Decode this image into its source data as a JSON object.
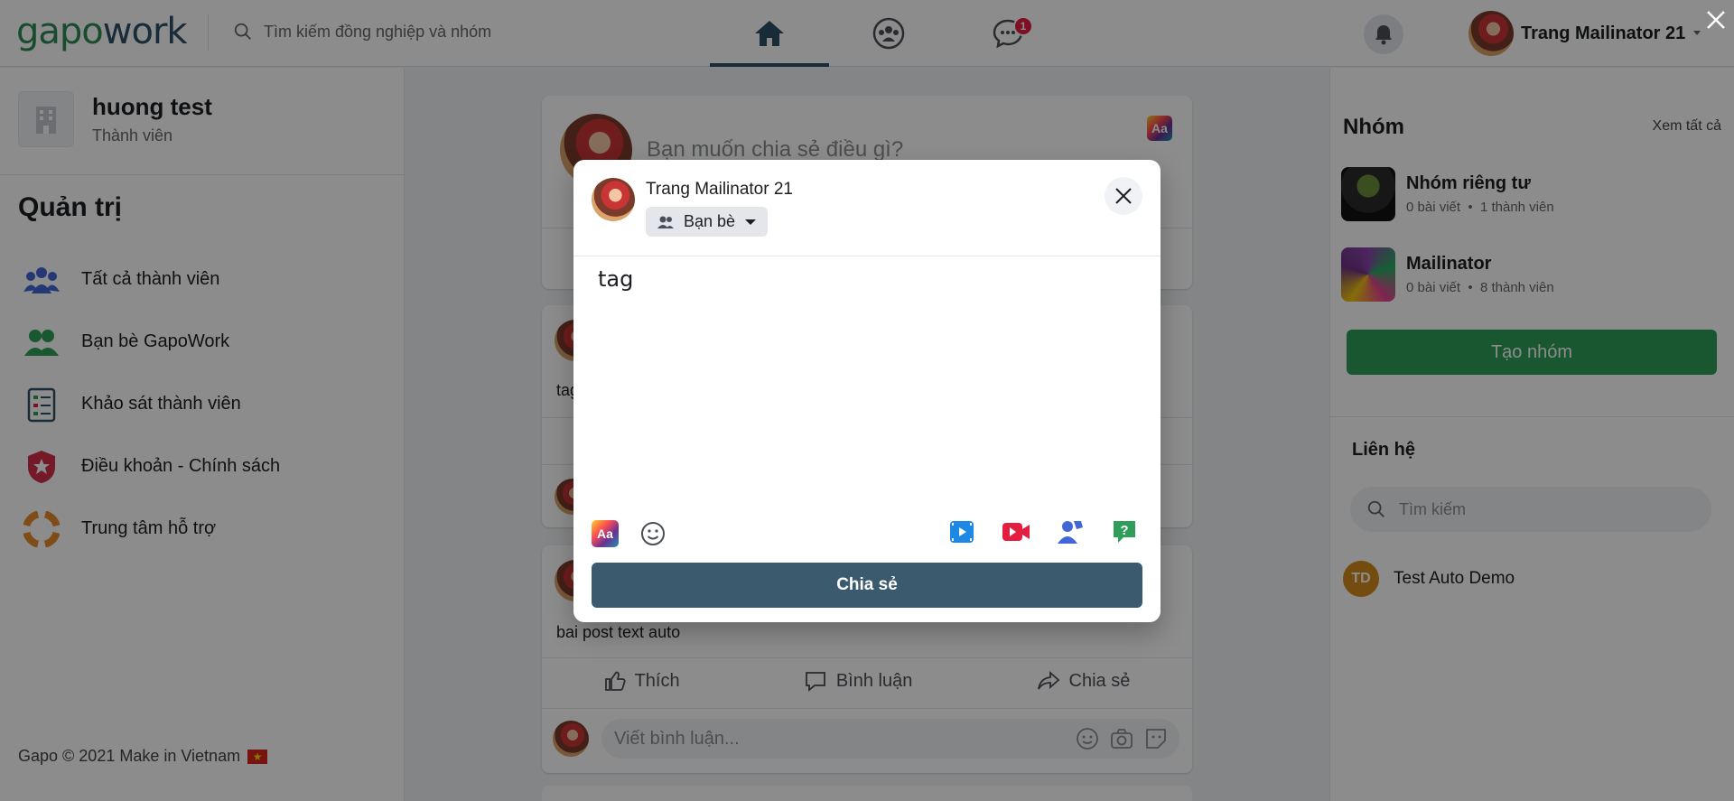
{
  "header": {
    "logo_part1": "gapo",
    "logo_part2": "work",
    "search_placeholder": "Tìm kiếm đồng nghiệp và nhóm",
    "chat_badge": "1",
    "user_name": "Trang Mailinator 21",
    "colors": {
      "brand_green": "#2e8b57",
      "brand_navy": "#2b5166",
      "badge_red": "#e41e3f"
    }
  },
  "left_sidebar": {
    "org_name": "huong test",
    "org_role": "Thành viên",
    "admin_title": "Quản trị",
    "menu": [
      {
        "label": "Tất cả thành viên",
        "icon": "members-icon"
      },
      {
        "label": "Bạn bè GapoWork",
        "icon": "friends-icon"
      },
      {
        "label": "Khảo sát thành viên",
        "icon": "survey-icon"
      },
      {
        "label": "Điều khoản - Chính sách",
        "icon": "policy-shield-icon"
      },
      {
        "label": "Trung tâm hỗ trợ",
        "icon": "lifebuoy-icon"
      }
    ],
    "footer": "Gapo © 2021 Make in Vietnam"
  },
  "feed": {
    "composer_placeholder": "Bạn muốn chia sẻ điều gì?",
    "post1_text": "tag",
    "post2_text": "bai post text auto",
    "actions": {
      "like": "Thích",
      "comment": "Bình luận",
      "share": "Chia sẻ"
    },
    "comment_placeholder": "Viết bình luận..."
  },
  "right_sidebar": {
    "groups_title": "Nhóm",
    "see_all": "Xem tất cả",
    "groups": [
      {
        "name": "Nhóm riêng tư",
        "posts": "0 bài viết",
        "members": "1 thành viên"
      },
      {
        "name": "Mailinator",
        "posts": "0 bài viết",
        "members": "8 thành viên"
      }
    ],
    "create_group": "Tạo nhóm",
    "contacts_title": "Liên hệ",
    "contacts_search_placeholder": "Tìm kiếm",
    "contacts": [
      {
        "initials": "TD",
        "name": "Test Auto Demo"
      }
    ]
  },
  "modal": {
    "author": "Trang Mailinator 21",
    "privacy": "Bạn bè",
    "content": "tag",
    "share_button": "Chia sẻ",
    "aa_label": "Aa"
  }
}
